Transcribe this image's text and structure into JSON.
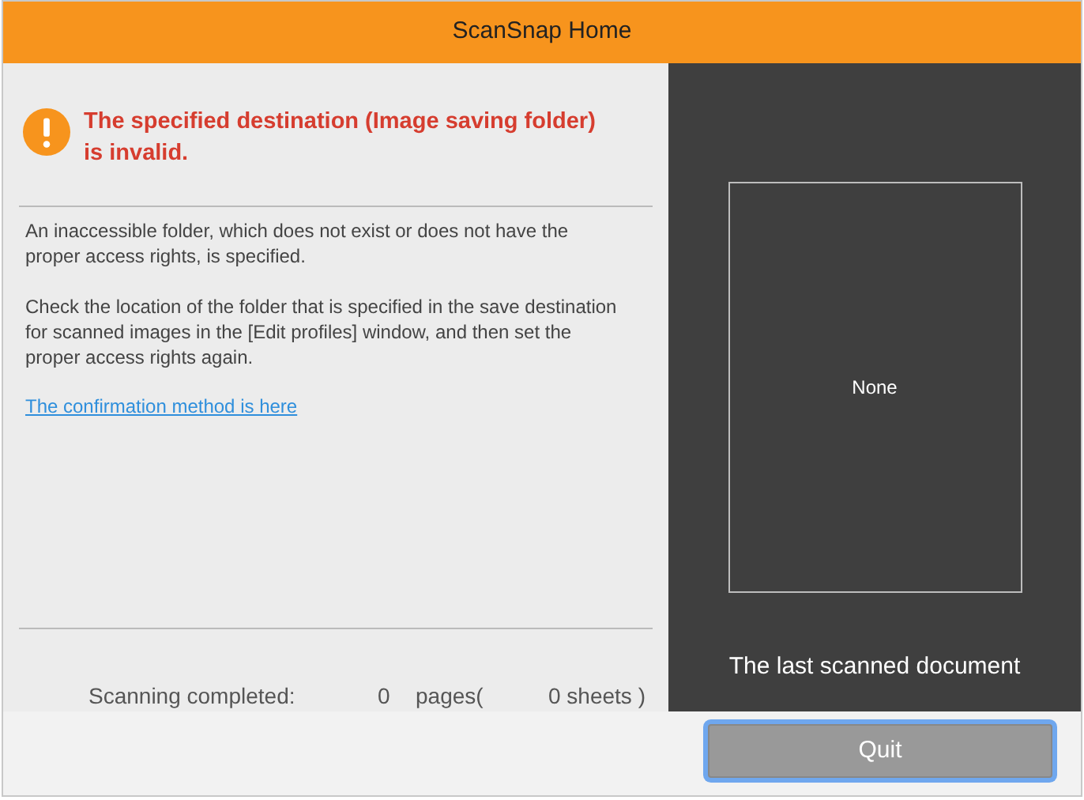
{
  "window": {
    "title": "ScanSnap Home"
  },
  "message": {
    "title": "The specified destination (Image saving folder) is invalid.",
    "paragraphs": [
      "An inaccessible folder, which does not exist or does not have the proper access rights, is specified.",
      "Check the location of the folder that is specified in the save destination for scanned images in the [Edit profiles] window, and then set the proper access rights again."
    ],
    "link": "The confirmation method is here"
  },
  "status": {
    "label": "Scanning completed:",
    "pages": "0",
    "pages_label": "pages(",
    "sheets": "0 sheets )"
  },
  "preview": {
    "placeholder": "None",
    "caption": "The last scanned document"
  },
  "buttons": [
    {
      "label": "Quit",
      "focused": true
    }
  ]
}
